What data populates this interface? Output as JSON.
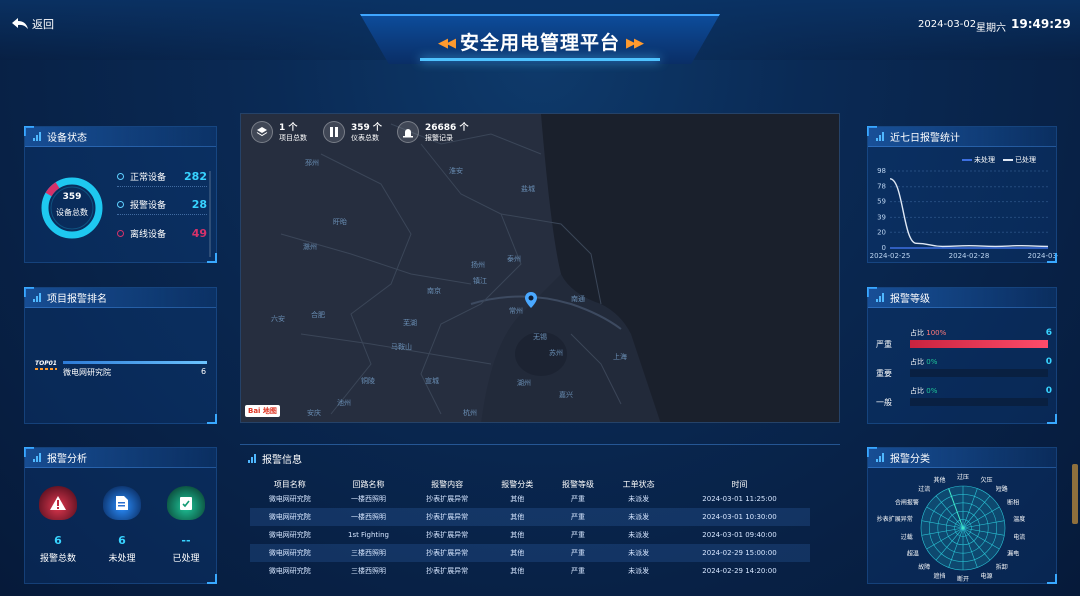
{
  "header": {
    "back_label": "返回",
    "title": "安全用电管理平台",
    "date": "2024-03-02",
    "weekday": "星期六",
    "time": "19:49:29"
  },
  "device_status": {
    "title": "设备状态",
    "total": "359",
    "total_label": "设备总数",
    "rows": [
      {
        "label": "正常设备",
        "value": "282"
      },
      {
        "label": "报警设备",
        "value": "28"
      },
      {
        "label": "离线设备",
        "value": "49"
      }
    ],
    "colors": {
      "normal": "#1ec8f0",
      "alarm": "#d6326a"
    }
  },
  "project_ranking": {
    "title": "项目报警排名",
    "items": [
      {
        "rank": "TOP01",
        "name": "微电网研究院",
        "value": "6",
        "fraction": 1.0
      }
    ]
  },
  "alarm_analysis": {
    "title": "报警分析",
    "items": [
      {
        "icon": "warning-icon",
        "value": "6",
        "label": "报警总数",
        "color": "#e0384f"
      },
      {
        "icon": "document-icon",
        "value": "6",
        "label": "未处理",
        "color": "#2b8fff"
      },
      {
        "icon": "clipboard-check-icon",
        "value": "--",
        "label": "已处理",
        "color": "#1fc79a"
      }
    ]
  },
  "map": {
    "stats": [
      {
        "icon": "layers-icon",
        "value": "1 个",
        "label": "项目总数"
      },
      {
        "icon": "gauge-icon",
        "value": "359 个",
        "label": "仪表总数"
      },
      {
        "icon": "alarm-light-icon",
        "value": "26686 个",
        "label": "报警记录"
      }
    ],
    "cities": [
      "邳州",
      "淮安",
      "盐城",
      "盱眙",
      "滁州",
      "扬州",
      "泰州",
      "南京",
      "镇江",
      "南通",
      "常州",
      "无锡",
      "苏州",
      "上海",
      "湖州",
      "嘉兴",
      "合肥",
      "六安",
      "芜湖",
      "马鞍山",
      "宣城",
      "铜陵",
      "池州",
      "安庆",
      "杭州"
    ],
    "logo_text": "Bai 地图"
  },
  "alarm_info": {
    "title": "报警信息",
    "columns": [
      "项目名称",
      "回路名称",
      "报警内容",
      "报警分类",
      "报警等级",
      "工单状态",
      "时间"
    ],
    "rows": [
      [
        "微电网研究院",
        "一楼西照明",
        "抄表扩展异常",
        "其他",
        "严重",
        "未派发",
        "2024-03-01 11:25:00"
      ],
      [
        "微电网研究院",
        "一楼西照明",
        "抄表扩展异常",
        "其他",
        "严重",
        "未派发",
        "2024-03-01 10:30:00"
      ],
      [
        "微电网研究院",
        "1st Fighting",
        "抄表扩展异常",
        "其他",
        "严重",
        "未派发",
        "2024-03-01 09:40:00"
      ],
      [
        "微电网研究院",
        "三楼西照明",
        "抄表扩展异常",
        "其他",
        "严重",
        "未派发",
        "2024-02-29 15:00:00"
      ],
      [
        "微电网研究院",
        "三楼西照明",
        "抄表扩展异常",
        "其他",
        "严重",
        "未派发",
        "2024-02-29 14:20:00"
      ]
    ]
  },
  "weekly_chart": {
    "title": "近七日报警统计",
    "legend": [
      "未处理",
      "已处理"
    ]
  },
  "chart_data": [
    {
      "type": "line",
      "title": "近七日报警统计",
      "x": [
        "2024-02-25",
        "2024-02-26",
        "2024-02-27",
        "2024-02-28",
        "2024-02-29",
        "2024-03-01",
        "2024-03-02"
      ],
      "x_tick_labels": [
        "2024-02-25",
        "2024-02-28",
        "2024-03-02"
      ],
      "y_ticks": [
        0,
        20,
        39,
        59,
        78,
        98
      ],
      "ylim": [
        0,
        98
      ],
      "series": [
        {
          "name": "未处理",
          "color": "#3d6fe0",
          "values": [
            0,
            0,
            0,
            0,
            0,
            0,
            0
          ]
        },
        {
          "name": "已处理",
          "color": "#dfe8f5",
          "values": [
            88,
            6,
            2,
            3,
            2,
            3,
            2
          ]
        }
      ],
      "legend": "top-right"
    },
    {
      "type": "radar",
      "title": "报警分类",
      "categories": [
        "过压",
        "欠压",
        "短路",
        "断相",
        "温度",
        "电流",
        "漏电",
        "拆卸",
        "电源",
        "断开",
        "遮挡",
        "故障",
        "超温",
        "过载",
        "抄表扩展异常",
        "合闸报警",
        "过流",
        "其他"
      ],
      "values": [
        0,
        0,
        0,
        0,
        0,
        0,
        0,
        0,
        0,
        0,
        0,
        0,
        0,
        0,
        0,
        0,
        0,
        6
      ],
      "max": 6
    }
  ],
  "alarm_level": {
    "title": "报警等级",
    "pct_label": "占比",
    "items": [
      {
        "name": "严重",
        "pct": "100%",
        "value": "6",
        "fraction": 1.0
      },
      {
        "name": "重要",
        "pct": "0%",
        "value": "0",
        "fraction": 0
      },
      {
        "name": "一般",
        "pct": "0%",
        "value": "0",
        "fraction": 0
      }
    ]
  },
  "alarm_category": {
    "title": "报警分类"
  }
}
